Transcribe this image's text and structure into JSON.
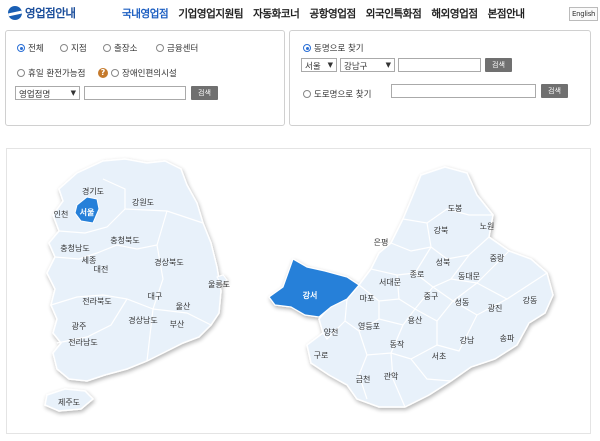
{
  "header": {
    "logo_text": "영업점안내",
    "nav": [
      "국내영업점",
      "기업영업지원팀",
      "자동화코너",
      "공항영업점",
      "외국인특화점",
      "해외영업점",
      "본점안내"
    ],
    "lang_button": "English"
  },
  "left_panel": {
    "type_options": [
      "전체",
      "지점",
      "출장소",
      "금융센터"
    ],
    "holiday_option": "휴일 환전가능점",
    "accessible_option": "장애인편의시설",
    "category_select": "영업점명",
    "search_button": "검색"
  },
  "right_panel": {
    "by_region_label": "동명으로 찾기",
    "city_select": "서울",
    "district_select": "강남구",
    "search_button_1": "검색",
    "by_road_label": "도로명으로 찾기",
    "search_button_2": "검색"
  },
  "korea_map": {
    "regions": [
      "경기도",
      "강원도",
      "인천",
      "서울",
      "충청북도",
      "충청남도",
      "세종",
      "대전",
      "경상북도",
      "전라북도",
      "대구",
      "울산",
      "울릉도",
      "광주",
      "경상남도",
      "부산",
      "전라남도",
      "제주도"
    ],
    "selected": "서울"
  },
  "seoul_map": {
    "districts": [
      "도봉",
      "강북",
      "노원",
      "은평",
      "성북",
      "중랑",
      "서대문",
      "종로",
      "동대문",
      "강서",
      "마포",
      "중구",
      "성동",
      "광진",
      "강동",
      "양천",
      "영등포",
      "용산",
      "구로",
      "동작",
      "강남",
      "송파",
      "서초",
      "금천",
      "관악"
    ],
    "selected": "강서"
  },
  "colors": {
    "accent": "#1d5fc2",
    "selected_region": "#2680d9",
    "map_fill": "#e8f1fa",
    "map_stroke": "#ffffff"
  }
}
